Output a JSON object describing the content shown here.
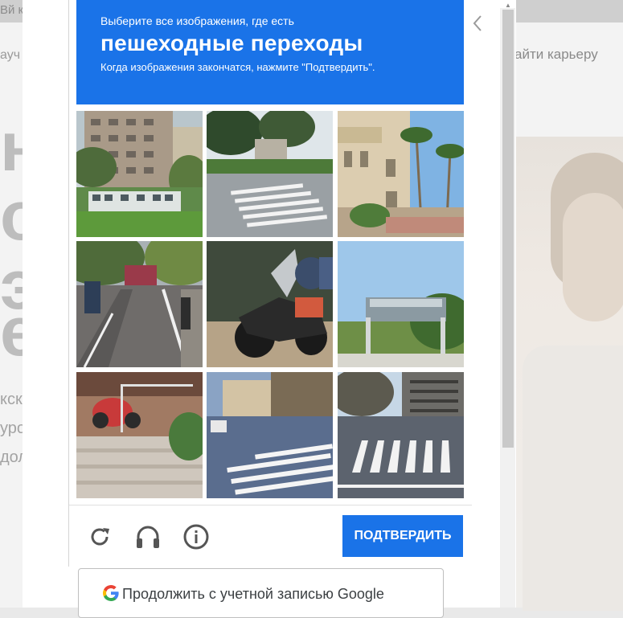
{
  "background": {
    "top_bar_text": "Вй карьеру",
    "nav_left": "ауч",
    "nav_right": "айти карьеру",
    "big_letters": [
      "на",
      "о",
      "эс",
      "е"
    ],
    "small_lines": [
      "кск",
      "уро",
      "дол"
    ]
  },
  "captcha": {
    "instruction": "Выберите все изображения, где есть",
    "target": "пешеходные переходы",
    "hint": "Когда изображения закончатся, нажмите \"Подтвердить\".",
    "tiles": [
      {
        "label": "building-bus"
      },
      {
        "label": "crosswalk-trees"
      },
      {
        "label": "palm-house"
      },
      {
        "label": "bike-lane"
      },
      {
        "label": "motorcycle"
      },
      {
        "label": "billboard-frame"
      },
      {
        "label": "red-motorcycle-steps"
      },
      {
        "label": "crosswalk-sunny"
      },
      {
        "label": "crosswalk-wide"
      }
    ],
    "verify_label": "ПОДТВЕРДИТЬ",
    "icons": [
      "reload-icon",
      "headphones-icon",
      "info-icon"
    ]
  },
  "google_button": {
    "label": "Продолжить с учетной записью Google"
  },
  "colors": {
    "accent": "#1a73e8"
  }
}
